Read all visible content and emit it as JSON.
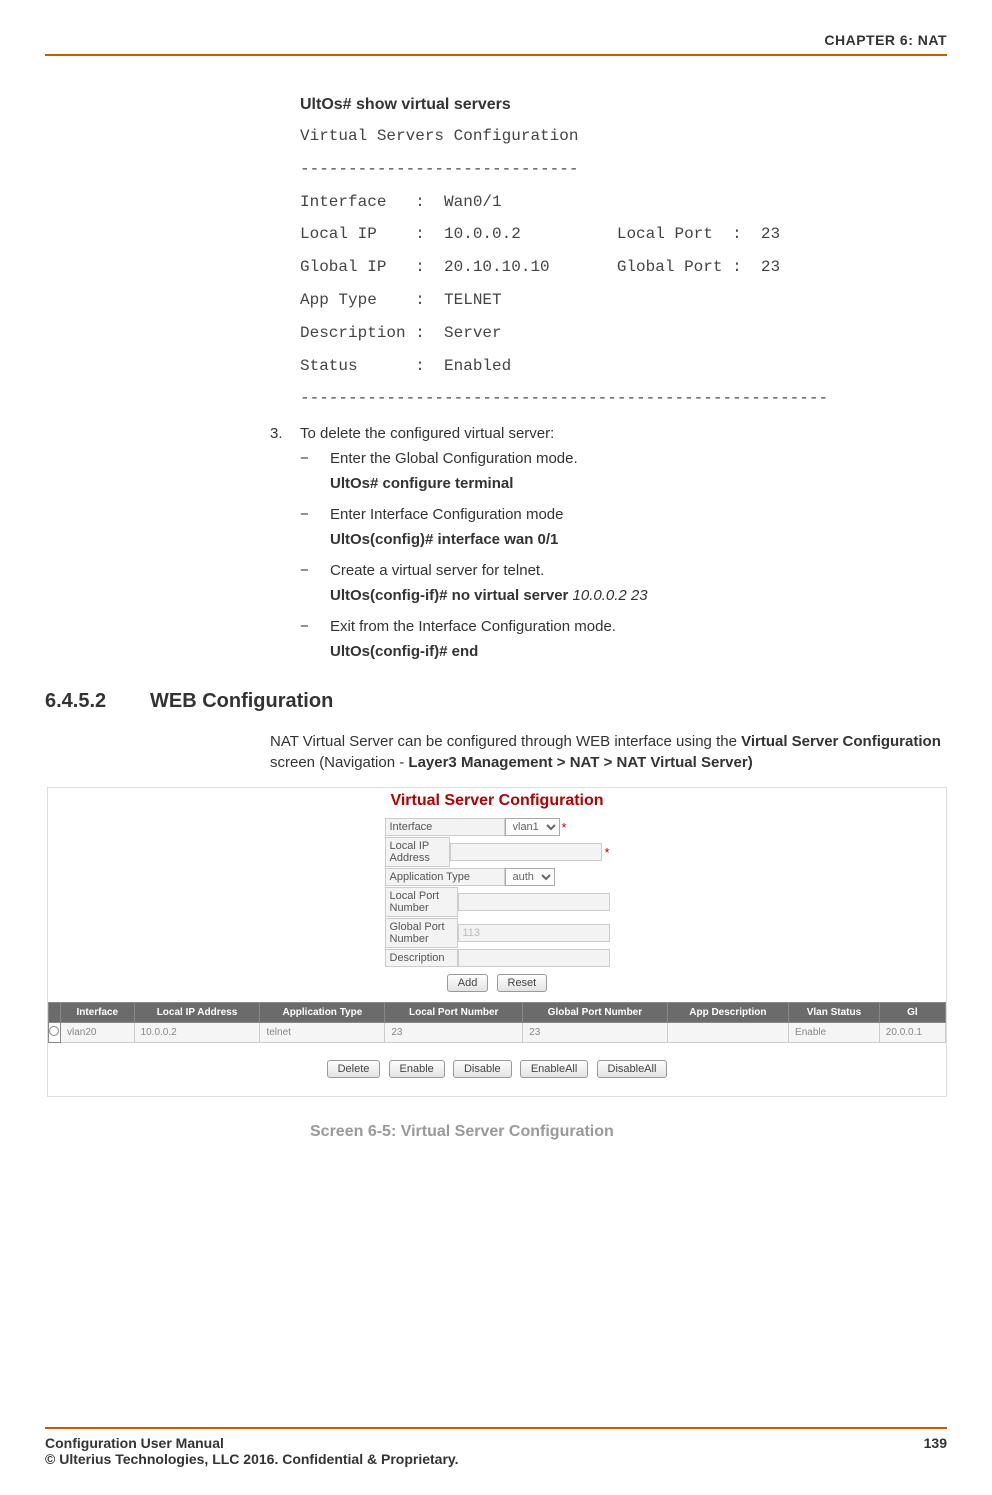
{
  "header": {
    "chapter": "CHAPTER 6: NAT"
  },
  "terminal": {
    "command": "UltOs# show virtual servers",
    "output": "Virtual Servers Configuration\n-----------------------------\nInterface   :  Wan0/1\nLocal IP    :  10.0.0.2          Local Port  :  23\nGlobal IP   :  20.10.10.10       Global Port :  23\nApp Type    :  TELNET\nDescription :  Server\nStatus      :  Enabled\n-------------------------------------------------------"
  },
  "step3": {
    "num": "3.",
    "text": "To delete the configured virtual server:",
    "subs": [
      {
        "dash": "−",
        "text": "Enter the Global Configuration mode.",
        "cmd": "UltOs# configure terminal"
      },
      {
        "dash": "−",
        "text": "Enter Interface Configuration mode",
        "cmd": "UltOs(config)# interface wan 0/1"
      },
      {
        "dash": "−",
        "text": "Create a virtual server for telnet.",
        "cmd": "UltOs(config-if)# no virtual server",
        "cmd_italic": " 10.0.0.2 23"
      },
      {
        "dash": "−",
        "text": "Exit from the Interface Configuration mode.",
        "cmd": "UltOs(config-if)# end"
      }
    ]
  },
  "section": {
    "num": "6.4.5.2",
    "title": "WEB Configuration",
    "para_pre": "NAT Virtual Server can be configured through WEB interface using the ",
    "para_bold1": "Virtual Server Configuration",
    "para_mid": " screen (Navigation - ",
    "para_bold2": "Layer3 Management > NAT > NAT Virtual Server)"
  },
  "screenshot": {
    "title": "Virtual Server Configuration",
    "form": {
      "interface_label": "Interface",
      "interface_value": "vlan1",
      "local_ip_label": "Local IP Address",
      "local_ip_value": "",
      "app_type_label": "Application Type",
      "app_type_value": "auth",
      "local_port_label": "Local Port Number",
      "local_port_value": "",
      "global_port_label": "Global Port Number",
      "global_port_value": "113",
      "description_label": "Description",
      "description_value": "",
      "btn_add": "Add",
      "btn_reset": "Reset"
    },
    "table": {
      "headers": [
        "",
        "Interface",
        "Local IP Address",
        "Application Type",
        "Local Port Number",
        "Global Port Number",
        "App Description",
        "Vlan Status",
        "Gl"
      ],
      "row": [
        "",
        "vlan20",
        "10.0.0.2",
        "telnet",
        "23",
        "23",
        "",
        "Enable",
        "20.0.0.1"
      ]
    },
    "bottom_buttons": [
      "Delete",
      "Enable",
      "Disable",
      "EnableAll",
      "DisableAll"
    ]
  },
  "caption": "Screen 6-5: Virtual Server Configuration",
  "footer": {
    "left1": "Configuration User Manual",
    "left2": "© Ulterius Technologies, LLC 2016. Confidential & Proprietary.",
    "right": "139"
  }
}
